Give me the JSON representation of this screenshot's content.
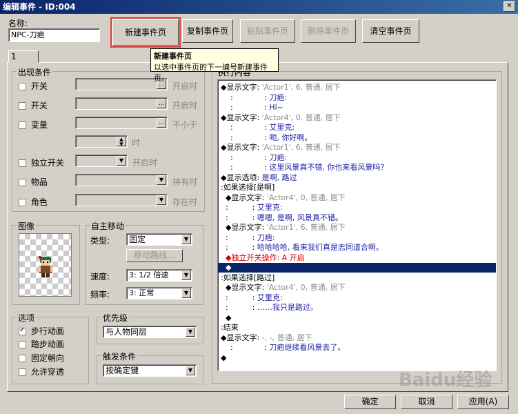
{
  "window": {
    "title": "编辑事件 - ID:004"
  },
  "name_label": "名称:",
  "name_value": "NPC-刀疤",
  "toolbar": {
    "new_page": "新建事件页",
    "copy_page": "复制事件页",
    "paste_page": "粘贴事件页",
    "delete_page": "删除事件页",
    "clear_page": "清空事件页"
  },
  "tooltip": {
    "title": "新建事件页",
    "text": "以选中事件页的下一编号新建事件页。"
  },
  "tab": {
    "label": "1"
  },
  "conditions": {
    "title": "出现条件",
    "switch1": {
      "label": "开关",
      "suffix": "开启时"
    },
    "switch2": {
      "label": "开关",
      "suffix": "开启时"
    },
    "variable": {
      "label": "变量",
      "suffix": "不小于"
    },
    "time_suffix": "时",
    "self_switch": {
      "label": "独立开关",
      "suffix": "开启时"
    },
    "item": {
      "label": "物品",
      "suffix": "持有时"
    },
    "actor": {
      "label": "角色",
      "suffix": "存在时"
    }
  },
  "image": {
    "title": "图像"
  },
  "autonomous": {
    "title": "自主移动",
    "type_label": "类型:",
    "type_value": "固定",
    "route_button": "移动路线...",
    "speed_label": "速度:",
    "speed_value": "3: 1/2 倍速",
    "freq_label": "频率:",
    "freq_value": "3: 正常"
  },
  "options": {
    "title": "选项",
    "walk": "步行动画",
    "step": "踏步动画",
    "fixed_dir": "固定朝向",
    "through": "允许穿透"
  },
  "priority": {
    "title": "优先级",
    "value": "与人物同层"
  },
  "trigger": {
    "title": "触发条件",
    "value": "按确定键"
  },
  "content_title": "执行内容",
  "commands": [
    {
      "parts": [
        {
          "t": "◆显示文字:",
          "c": "black"
        },
        {
          "t": " 'Actor1', 6, 普通, 居下",
          "c": "gray"
        }
      ]
    },
    {
      "parts": [
        {
          "t": "    :             : ",
          "c": "black"
        },
        {
          "t": "刀疤:",
          "c": "blue"
        }
      ]
    },
    {
      "parts": [
        {
          "t": "    :             : ",
          "c": "black"
        },
        {
          "t": "Hi~",
          "c": "blue"
        }
      ]
    },
    {
      "parts": [
        {
          "t": "◆显示文字:",
          "c": "black"
        },
        {
          "t": " 'Actor4', 0, 普通, 居下",
          "c": "gray"
        }
      ]
    },
    {
      "parts": [
        {
          "t": "    :             : ",
          "c": "black"
        },
        {
          "t": "艾里克:",
          "c": "blue"
        }
      ]
    },
    {
      "parts": [
        {
          "t": "    :             : ",
          "c": "black"
        },
        {
          "t": "呃, 你好啊。",
          "c": "blue"
        }
      ]
    },
    {
      "parts": [
        {
          "t": "◆显示文字:",
          "c": "black"
        },
        {
          "t": " 'Actor1', 6, 普通, 居下",
          "c": "gray"
        }
      ]
    },
    {
      "parts": [
        {
          "t": "    :             : ",
          "c": "black"
        },
        {
          "t": "刀疤:",
          "c": "blue"
        }
      ]
    },
    {
      "parts": [
        {
          "t": "    :             : ",
          "c": "black"
        },
        {
          "t": "这里风景真不错, 你也来看风景吗？",
          "c": "blue"
        }
      ]
    },
    {
      "parts": [
        {
          "t": "◆显示选项:",
          "c": "black"
        },
        {
          "t": " 是啊, 路过",
          "c": "blue"
        }
      ]
    },
    {
      "parts": [
        {
          "t": ":如果选择[是啊]",
          "c": "black"
        }
      ]
    },
    {
      "parts": [
        {
          "t": "  ◆显示文字:",
          "c": "black"
        },
        {
          "t": " 'Actor4', 0, 普通, 居下",
          "c": "gray"
        }
      ]
    },
    {
      "parts": [
        {
          "t": "  :          : ",
          "c": "black"
        },
        {
          "t": "艾里克:",
          "c": "blue"
        }
      ]
    },
    {
      "parts": [
        {
          "t": "  :          : ",
          "c": "black"
        },
        {
          "t": "嗯嗯, 是啊, 风景真不错。",
          "c": "blue"
        }
      ]
    },
    {
      "parts": [
        {
          "t": "  ◆显示文字:",
          "c": "black"
        },
        {
          "t": " 'Actor1', 6, 普通, 居下",
          "c": "gray"
        }
      ]
    },
    {
      "parts": [
        {
          "t": "  :          : ",
          "c": "black"
        },
        {
          "t": "刀疤:",
          "c": "blue"
        }
      ]
    },
    {
      "parts": [
        {
          "t": "  :          : ",
          "c": "black"
        },
        {
          "t": "哈哈哈哈, 看来我们真是志同道合啊。",
          "c": "blue"
        }
      ]
    },
    {
      "parts": [
        {
          "t": "  ◆独立开关操作: A 开启",
          "c": "red"
        }
      ]
    },
    {
      "parts": [
        {
          "t": "  ◆",
          "c": "white"
        }
      ],
      "selected": true
    },
    {
      "parts": [
        {
          "t": ":如果选择[路过]",
          "c": "black"
        }
      ]
    },
    {
      "parts": [
        {
          "t": "  ◆显示文字:",
          "c": "black"
        },
        {
          "t": " 'Actor4', 0, 普通, 居下",
          "c": "gray"
        }
      ]
    },
    {
      "parts": [
        {
          "t": "  :          : ",
          "c": "black"
        },
        {
          "t": "艾里克:",
          "c": "blue"
        }
      ]
    },
    {
      "parts": [
        {
          "t": "  :          : ",
          "c": "black"
        },
        {
          "t": "……我只是路过。",
          "c": "blue"
        }
      ]
    },
    {
      "parts": [
        {
          "t": "  ◆",
          "c": "black"
        }
      ]
    },
    {
      "parts": [
        {
          "t": ":结束",
          "c": "black"
        }
      ]
    },
    {
      "parts": [
        {
          "t": "◆显示文字:",
          "c": "black"
        },
        {
          "t": " -, -, 普通, 居下",
          "c": "gray"
        }
      ]
    },
    {
      "parts": [
        {
          "t": "    :             : ",
          "c": "black"
        },
        {
          "t": "刀疤继续看风景去了。",
          "c": "blue"
        }
      ]
    },
    {
      "parts": [
        {
          "t": "◆",
          "c": "black"
        }
      ]
    }
  ],
  "footer": {
    "ok": "确定",
    "cancel": "取消",
    "apply": "应用(A)"
  },
  "watermark": "Baidu经验"
}
